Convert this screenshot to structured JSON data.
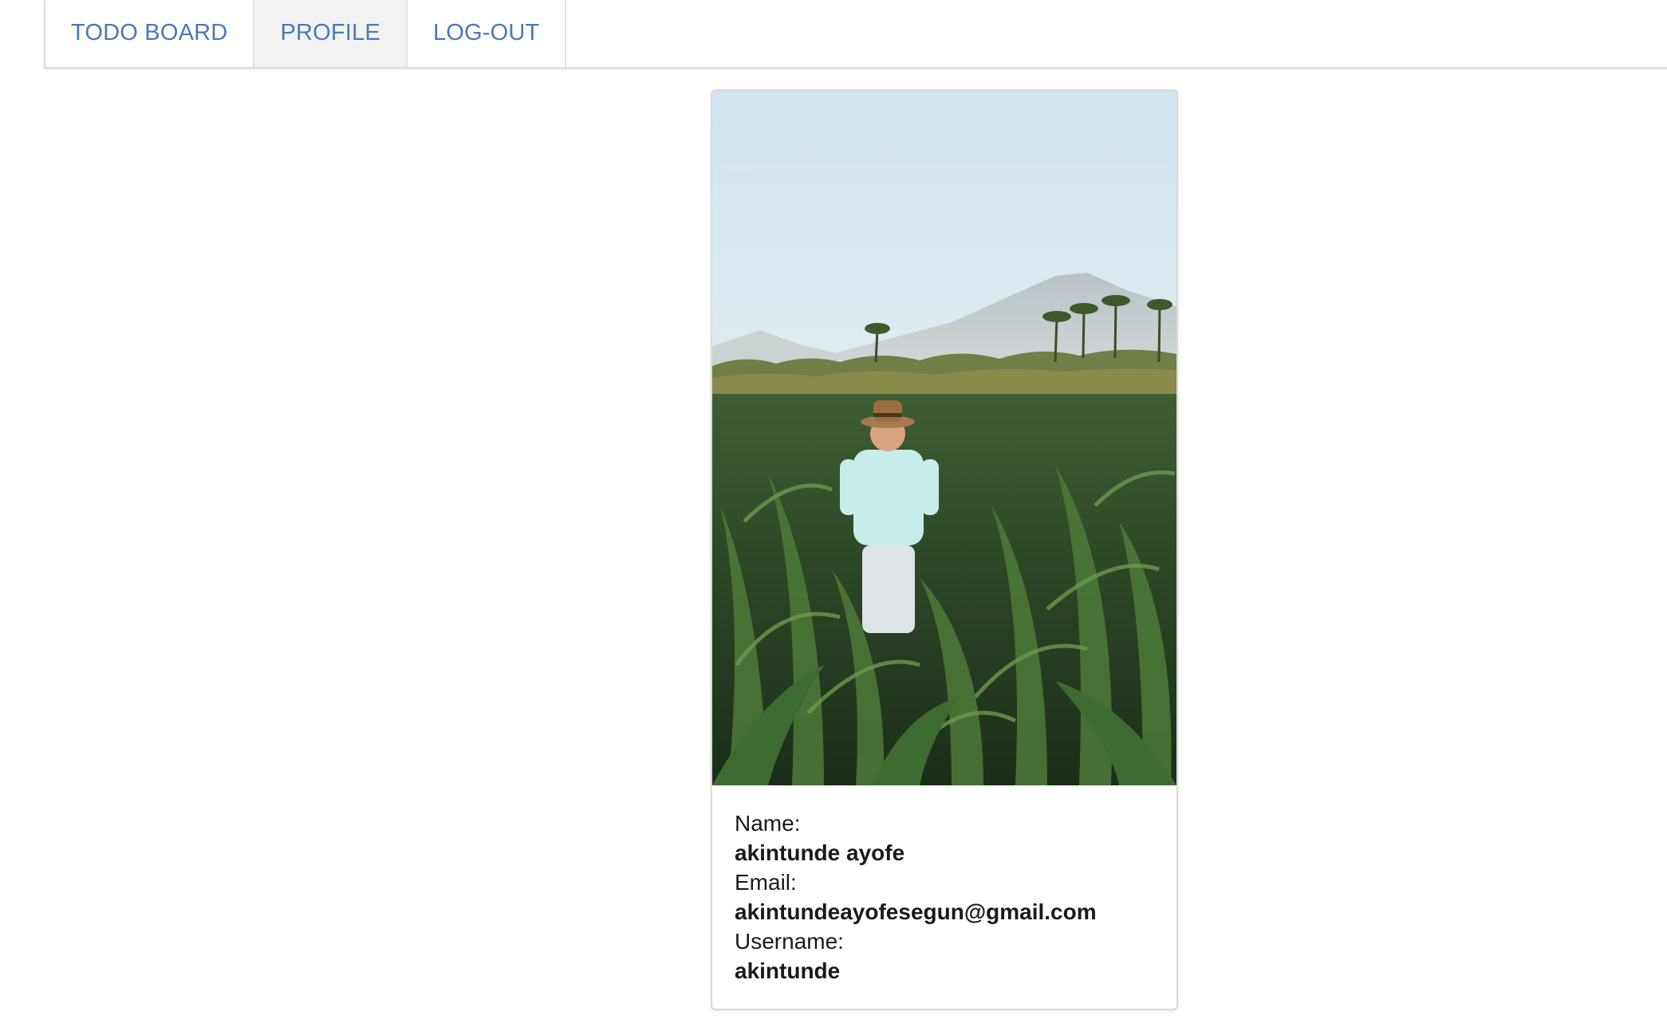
{
  "nav": {
    "items": [
      {
        "label": "TODO BOARD",
        "active": false
      },
      {
        "label": "PROFILE",
        "active": true
      },
      {
        "label": "LOG-OUT",
        "active": false
      }
    ],
    "link_color": "#4a78b8",
    "active_bg": "#f2f2f2"
  },
  "profile": {
    "image_description_icon": "profile-photo",
    "name_label": "Name:",
    "name_value": "akintunde ayofe",
    "email_label": "Email:",
    "email_value": "akintundeayofesegun@gmail.com",
    "username_label": "Username:",
    "username_value": "akintunde"
  }
}
